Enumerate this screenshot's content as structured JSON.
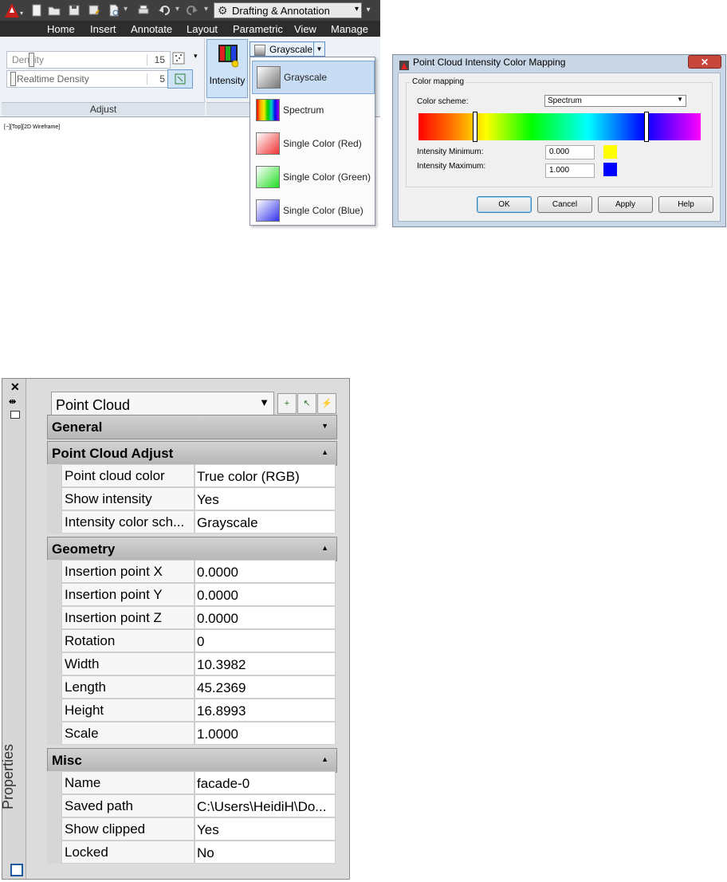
{
  "ribbon": {
    "workspace": "Drafting & Annotation",
    "tabs": [
      "Home",
      "Insert",
      "Annotate",
      "Layout",
      "Parametric",
      "View",
      "Manage"
    ],
    "density_label": "Density",
    "density_value": "15",
    "realtime_label": "Realtime Density",
    "realtime_value": "5",
    "panel_title": "Adjust",
    "intensity_label": "Intensity",
    "colorscale_selected": "Grayscale",
    "colorscale_options": [
      "Grayscale",
      "Spectrum",
      "Single Color (Red)",
      "Single Color (Green)",
      "Single Color (Blue)"
    ],
    "viewport_label": "[−][Top][2D Wireframe]"
  },
  "dialog": {
    "title": "Point Cloud Intensity Color Mapping",
    "group_label": "Color mapping",
    "scheme_label": "Color scheme:",
    "scheme_value": "Spectrum",
    "min_label": "Intensity Minimum:",
    "min_value": "0.000",
    "min_color": "#ffff00",
    "max_label": "Intensity Maximum:",
    "max_value": "1.000",
    "max_color": "#0000ff",
    "buttons": [
      "OK",
      "Cancel",
      "Apply",
      "Help"
    ]
  },
  "palette": {
    "title": "Properties",
    "object_type": "Point Cloud",
    "categories": {
      "general": "General",
      "adjust": "Point Cloud Adjust",
      "geometry": "Geometry",
      "misc": "Misc"
    },
    "adjust_rows": [
      {
        "k": "Point cloud color",
        "v": "True color (RGB)"
      },
      {
        "k": "Show intensity",
        "v": "Yes"
      },
      {
        "k": "Intensity color sch...",
        "v": "Grayscale"
      }
    ],
    "geometry_rows": [
      {
        "k": "Insertion point X",
        "v": "0.0000"
      },
      {
        "k": "Insertion point Y",
        "v": "0.0000"
      },
      {
        "k": "Insertion point Z",
        "v": "0.0000"
      },
      {
        "k": "Rotation",
        "v": "0"
      },
      {
        "k": "Width",
        "v": "10.3982"
      },
      {
        "k": "Length",
        "v": "45.2369"
      },
      {
        "k": "Height",
        "v": "16.8993"
      },
      {
        "k": "Scale",
        "v": "1.0000"
      }
    ],
    "misc_rows": [
      {
        "k": "Name",
        "v": "facade-0"
      },
      {
        "k": "Saved path",
        "v": "C:\\Users\\HeidiH\\Do..."
      },
      {
        "k": "Show clipped",
        "v": "Yes"
      },
      {
        "k": "Locked",
        "v": "No"
      }
    ]
  }
}
